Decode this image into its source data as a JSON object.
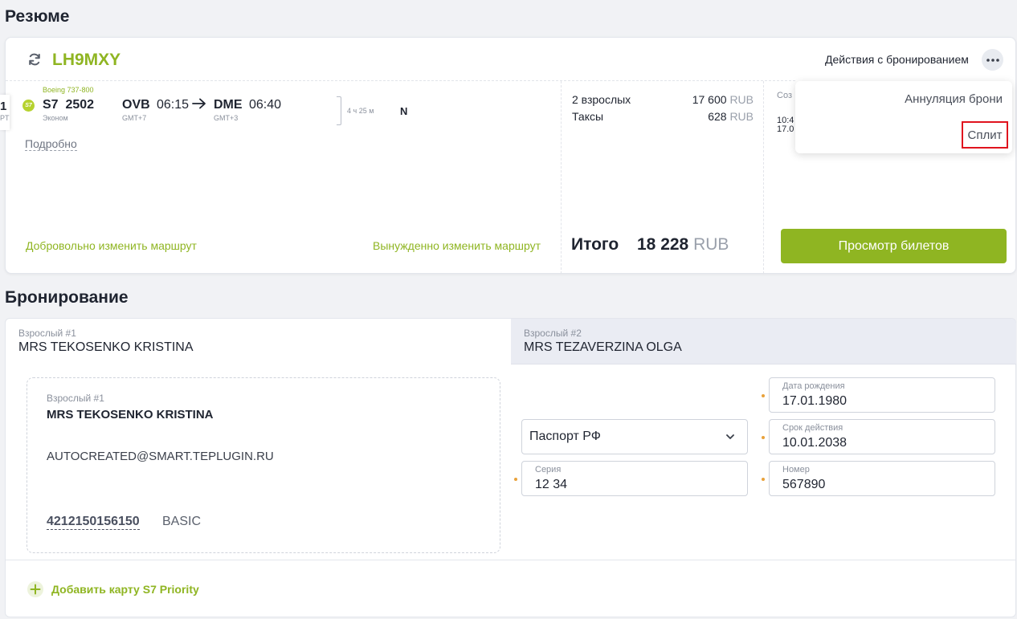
{
  "summary": {
    "title": "Резюме",
    "pnr": "LH9MXY",
    "actions_label": "Действия с бронированием",
    "aircraft": "Boeing 737-800",
    "clipped_code": "1",
    "clipped_tz": "PT",
    "airline_logo": "S7",
    "flight": "S7  2502",
    "cabin": "Эконом",
    "origin": "OVB",
    "dep_time": "06:15",
    "origin_tz": "GMT+7",
    "dest": "DME",
    "arr_time": "06:40",
    "dest_tz": "GMT+3",
    "duration": "4 ч 25 м",
    "class_code": "N",
    "details_link": "Подробно",
    "change_voluntary": "Добровольно изменить маршрут",
    "change_forced": "Вынужденно изменить маршрут",
    "fare_rows": [
      {
        "label": "2 взрослых",
        "amount": "17 600",
        "currency": "RUB"
      },
      {
        "label": "Таксы",
        "amount": "628",
        "currency": "RUB"
      }
    ],
    "total_label": "Итого",
    "total_amount": "18 228",
    "total_currency": "RUB",
    "created_label": "Соз",
    "created_time": "10:4",
    "created_date": "17.0",
    "view_tickets": "Просмотр билетов"
  },
  "menu": {
    "items": [
      "Аннуляция брони",
      "Сплит"
    ]
  },
  "booking": {
    "title": "Бронирование",
    "tabs": [
      {
        "label": "Взрослый #1",
        "name": "MRS TEKOSENKO KRISTINA"
      },
      {
        "label": "Взрослый #2",
        "name": "MRS TEZAVERZINA OLGA"
      }
    ],
    "passenger": {
      "label": "Взрослый #1",
      "name": "MRS TEKOSENKO KRISTINA",
      "email": "AUTOCREATED@SMART.TEPLUGIN.RU",
      "loyalty_number": "4212150156150",
      "loyalty_level": "BASIC"
    },
    "document": {
      "doc_type": "Паспорт РФ",
      "birth_label": "Дата рождения",
      "birth_value": "17.01.1980",
      "expiry_label": "Срок действия",
      "expiry_value": "10.01.2038",
      "series_label": "Серия",
      "series_value": "12 34",
      "number_label": "Номер",
      "number_value": "567890"
    },
    "add_card": "Добавить карту S7 Priority"
  },
  "colors": {
    "accent": "#8fb522",
    "highlight": "#e0141e",
    "required": "#e9a23b"
  }
}
